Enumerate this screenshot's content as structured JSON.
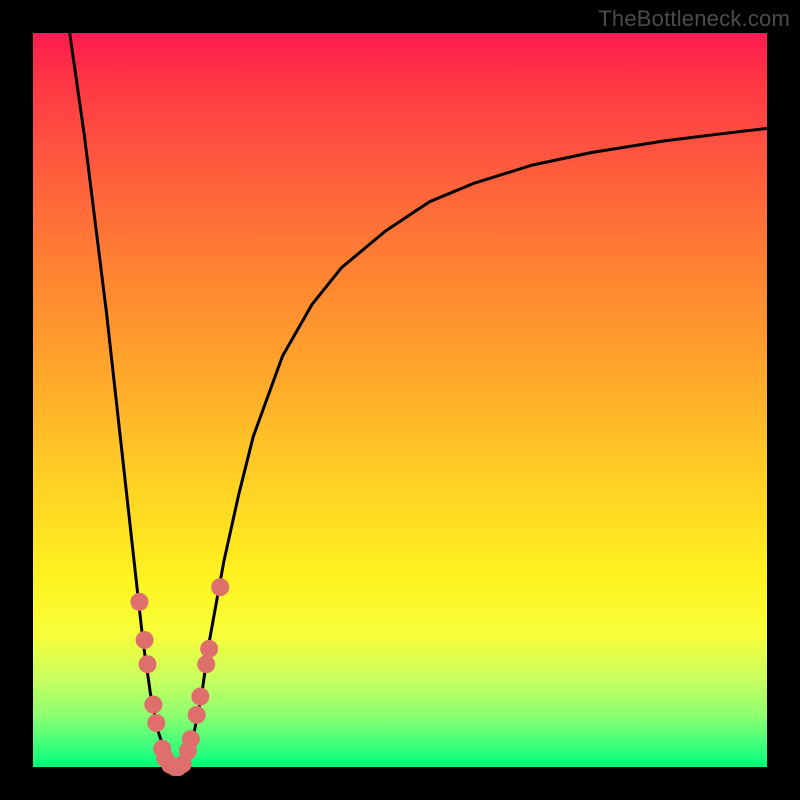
{
  "watermark": "TheBottleneck.com",
  "chart_data": {
    "type": "line",
    "title": "",
    "xlabel": "",
    "ylabel": "",
    "xlim": [
      0,
      100
    ],
    "ylim": [
      0,
      100
    ],
    "grid": false,
    "series": [
      {
        "name": "bottleneck-curve",
        "x": [
          5,
          6,
          7,
          8,
          9,
          10,
          11,
          12,
          13,
          14,
          15,
          16,
          17,
          18,
          19,
          20,
          21,
          22,
          23,
          24,
          26,
          28,
          30,
          34,
          38,
          42,
          48,
          54,
          60,
          68,
          76,
          86,
          94,
          100
        ],
        "values": [
          100,
          93,
          86,
          78,
          70,
          62,
          53,
          44,
          35,
          26,
          17,
          10,
          5,
          2,
          0,
          0,
          2,
          5,
          10,
          17,
          28,
          37,
          45,
          56,
          63,
          68,
          73,
          77,
          79.5,
          82,
          83.7,
          85.3,
          86.3,
          87
        ]
      }
    ],
    "markers": [
      {
        "name": "data-points-left",
        "x": [
          14.5,
          15.2,
          15.6,
          16.4,
          16.8,
          17.6,
          18.0
        ],
        "values": [
          22.5,
          17.3,
          14.0,
          8.5,
          6.0,
          2.5,
          1.2
        ]
      },
      {
        "name": "data-points-bottom",
        "x": [
          18.7,
          19.3,
          19.8,
          20.4
        ],
        "values": [
          0.3,
          0.0,
          0.0,
          0.4
        ]
      },
      {
        "name": "data-points-right",
        "x": [
          21.1,
          21.5,
          22.3,
          22.8,
          23.6,
          24.0,
          25.5
        ],
        "values": [
          2.2,
          3.8,
          7.1,
          9.6,
          14.0,
          16.1,
          24.5
        ]
      }
    ],
    "marker_style": {
      "fill": "#df6f6c",
      "radius_px": 9
    }
  }
}
